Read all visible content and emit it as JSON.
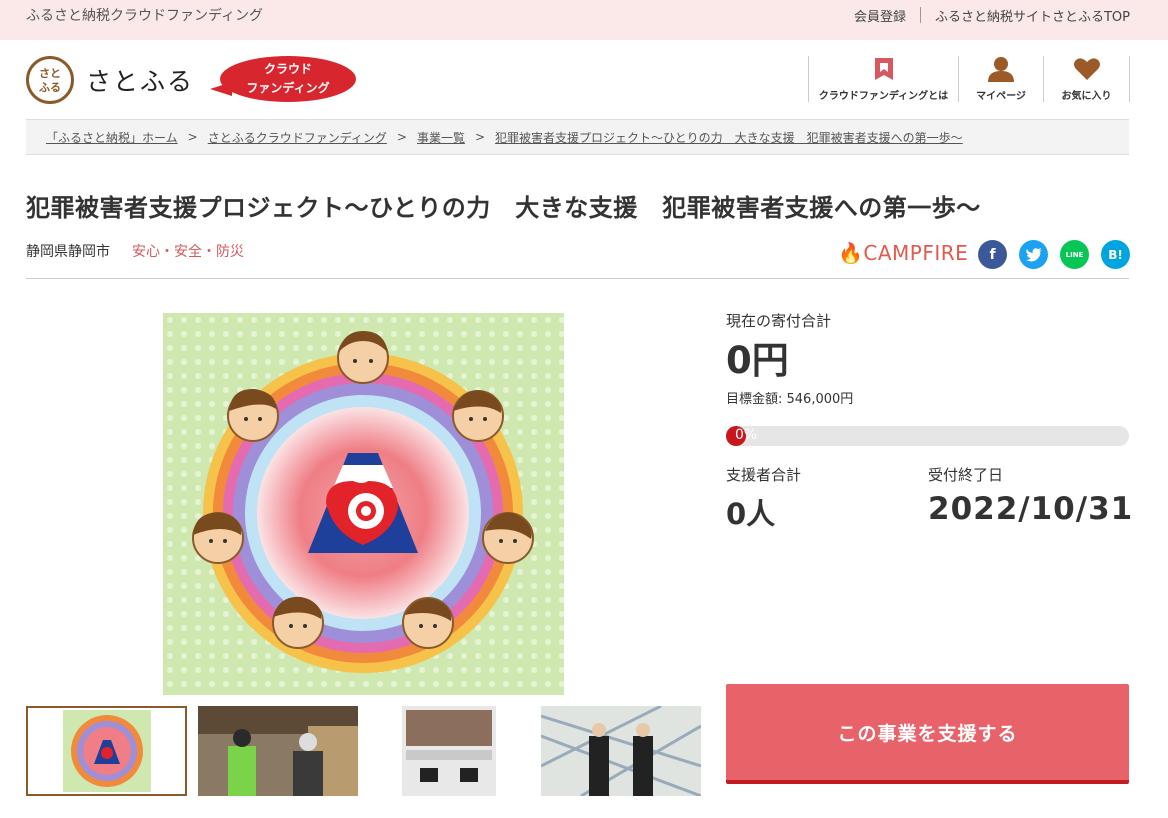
{
  "topbar": {
    "site_name": "ふるさと納税クラウドファンディング",
    "links": [
      "会員登録",
      "ふるさと納税サイトさとふるTOP"
    ]
  },
  "header": {
    "logo_mark": "さとふる",
    "logo_text": "さとふる",
    "badge_line1": "クラウド",
    "badge_line2": "ファンディング",
    "nav": [
      {
        "label": "クラウドファンディングとは",
        "icon": "book-icon"
      },
      {
        "label": "マイページ",
        "icon": "user-icon"
      },
      {
        "label": "お気に入り",
        "icon": "heart-icon"
      }
    ]
  },
  "breadcrumb": [
    "「ふるさと納税」ホーム",
    "さとふるクラウドファンディング",
    "事業一覧",
    "犯罪被害者支援プロジェクト～ひとりの力　大きな支援　犯罪被害者支援への第一歩～"
  ],
  "project": {
    "title": "犯罪被害者支援プロジェクト～ひとりの力　大きな支援　犯罪被害者支援への第一歩～",
    "location": "静岡県静岡市",
    "category": "安心・安全・防災",
    "platform": "CAMPFIRE"
  },
  "share": [
    "facebook-icon",
    "twitter-icon",
    "line-icon",
    "hatena-bookmark-icon"
  ],
  "share_labels": {
    "facebook": "f",
    "line": "LINE",
    "hatena": "B!"
  },
  "stats": {
    "total_label": "現在の寄付合計",
    "total_value": "0円",
    "goal_label": "目標金額: ",
    "goal_value": "546,000円",
    "progress_text": "0%",
    "progress": 0,
    "backers_label": "支援者合計",
    "backers_value": "0人",
    "deadline_label": "受付終了日",
    "deadline_value": "2022/10/31"
  },
  "cta": {
    "label": "この事業を支援する"
  },
  "colors": {
    "accent": "#e8626a",
    "brand_red": "#d8262e",
    "brown": "#8a5a2b",
    "topbar": "#fbe9e9"
  }
}
